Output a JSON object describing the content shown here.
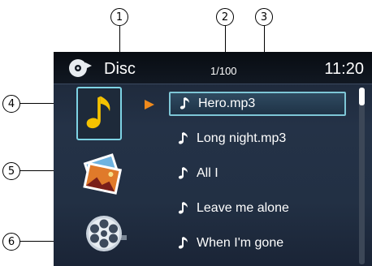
{
  "callouts": [
    "1",
    "2",
    "3",
    "4",
    "5",
    "6"
  ],
  "status_bar": {
    "source": "Disc",
    "track_counter": "1/100",
    "clock": "11:20",
    "source_icon": "disc-icon"
  },
  "media_types": [
    {
      "name": "music",
      "icon": "music-note-icon",
      "selected": true
    },
    {
      "name": "photo",
      "icon": "photo-icon",
      "selected": false
    },
    {
      "name": "video",
      "icon": "film-reel-icon",
      "selected": false
    }
  ],
  "tracks": [
    {
      "title": "Hero.mp3",
      "selected": true
    },
    {
      "title": "Long night.mp3",
      "selected": false
    },
    {
      "title": "All I",
      "selected": false
    },
    {
      "title": "Leave me alone",
      "selected": false
    },
    {
      "title": "When I'm gone",
      "selected": false
    }
  ],
  "colors": {
    "selection_border": "#7ec6d6",
    "play_arrow": "#f08a1c",
    "music_icon": "#f5c200",
    "screen_bg": "#223044"
  }
}
